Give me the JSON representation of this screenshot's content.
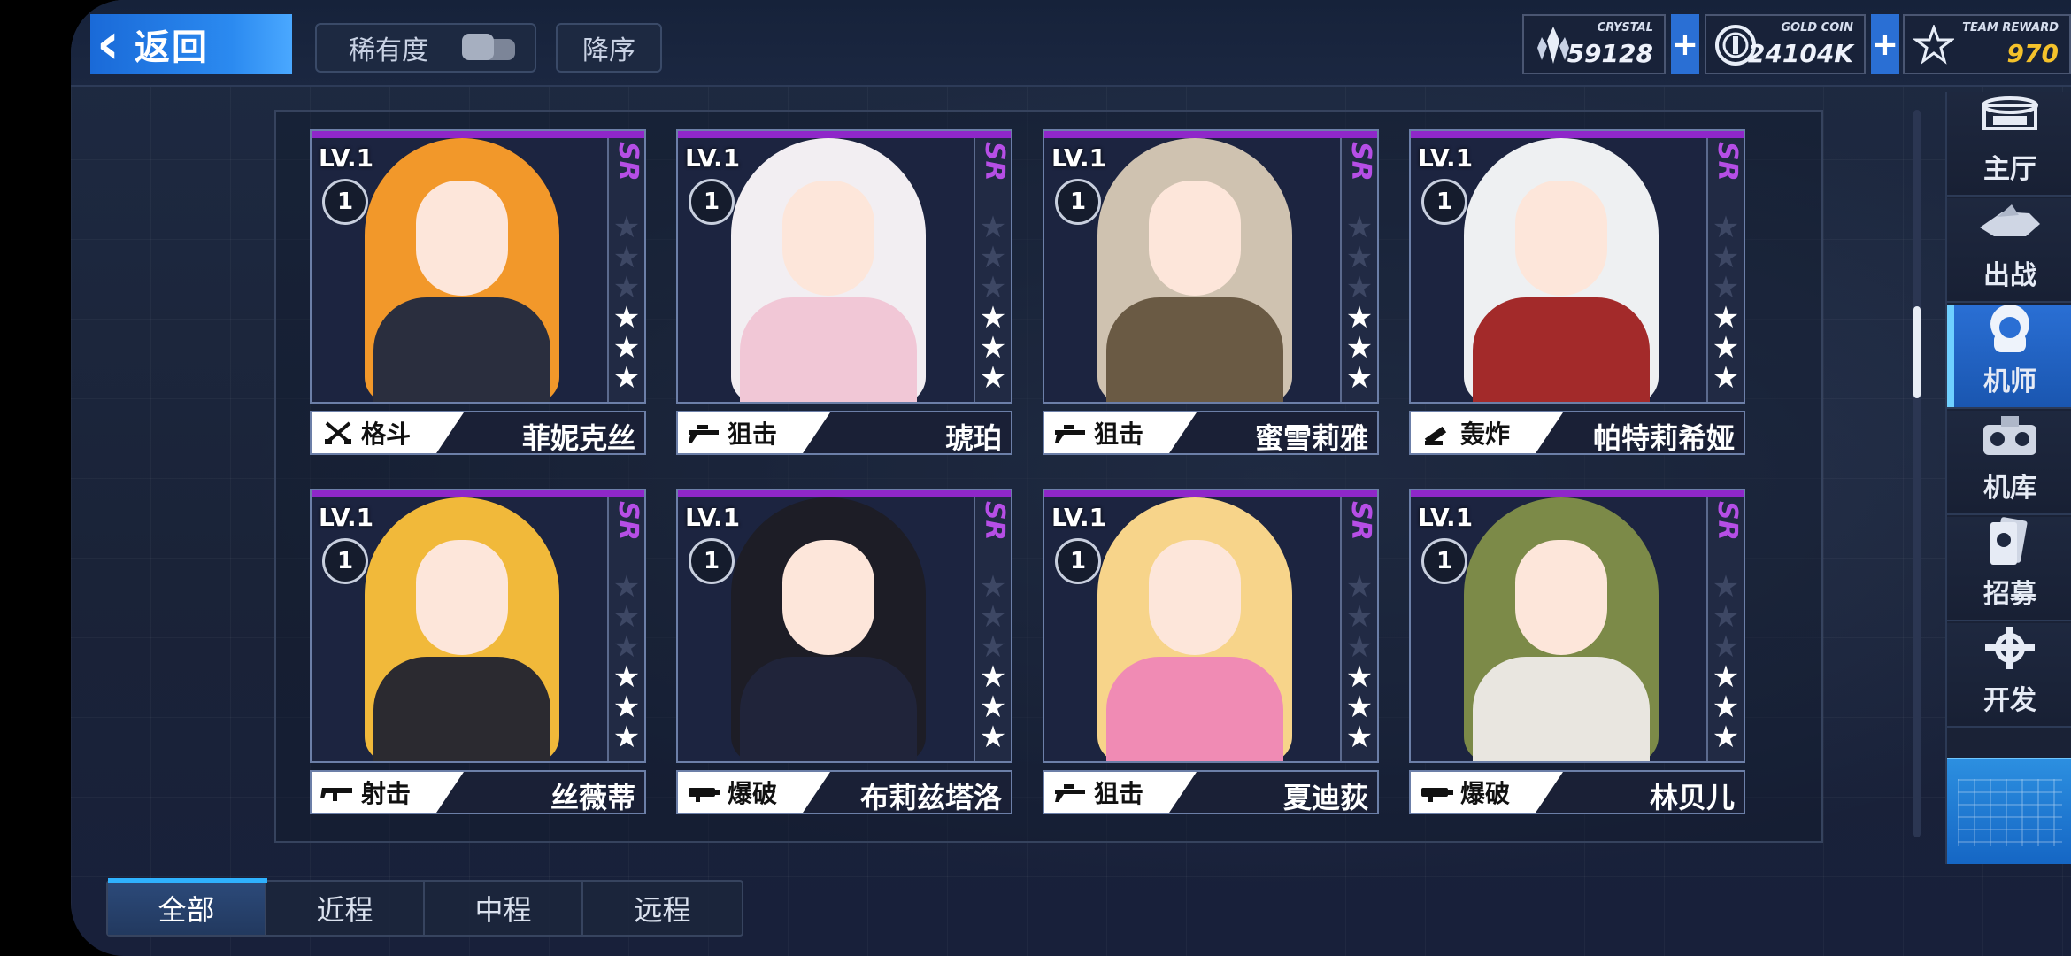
{
  "header": {
    "back_label": "返回",
    "rarity_label": "稀有度",
    "order_label": "降序"
  },
  "currencies": {
    "crystal": {
      "caption": "CRYSTAL",
      "value": "59128",
      "plus": "+"
    },
    "gold": {
      "caption": "GOLD COIN",
      "value": "24104K",
      "plus": "+"
    },
    "reward": {
      "caption": "TEAM REWARD",
      "value": "970"
    }
  },
  "nav": {
    "items": [
      {
        "label": "主厅",
        "icon": "hall-icon"
      },
      {
        "label": "出战",
        "icon": "sortie-icon"
      },
      {
        "label": "机师",
        "icon": "pilot-icon",
        "active": true
      },
      {
        "label": "机库",
        "icon": "hangar-icon"
      },
      {
        "label": "招募",
        "icon": "recruit-icon"
      },
      {
        "label": "开发",
        "icon": "develop-icon"
      }
    ]
  },
  "cards": [
    {
      "lv": "LV.1",
      "badge": "1",
      "rarity": "SR",
      "stars": 3,
      "role": "格斗",
      "role_icon": "melee-icon",
      "name": "菲妮克丝",
      "hair": "#f2982a",
      "outfit": "#2a2e3e"
    },
    {
      "lv": "LV.1",
      "badge": "1",
      "rarity": "SR",
      "stars": 3,
      "role": "狙击",
      "role_icon": "sniper-icon",
      "name": "琥珀",
      "hair": "#f2eef2",
      "outfit": "#f1c7d6"
    },
    {
      "lv": "LV.1",
      "badge": "1",
      "rarity": "SR",
      "stars": 3,
      "role": "狙击",
      "role_icon": "sniper-icon",
      "name": "蜜雪莉雅",
      "hair": "#cfc2b0",
      "outfit": "#6a5a44"
    },
    {
      "lv": "LV.1",
      "badge": "1",
      "rarity": "SR",
      "stars": 3,
      "role": "轰炸",
      "role_icon": "bomber-icon",
      "name": "帕特莉希娅",
      "hair": "#eef0f2",
      "outfit": "#a32a2a"
    },
    {
      "lv": "LV.1",
      "badge": "1",
      "rarity": "SR",
      "stars": 3,
      "role": "射击",
      "role_icon": "rifle-icon",
      "name": "丝薇蒂",
      "hair": "#f1b93a",
      "outfit": "#2b2a30"
    },
    {
      "lv": "LV.1",
      "badge": "1",
      "rarity": "SR",
      "stars": 3,
      "role": "爆破",
      "role_icon": "demolition-icon",
      "name": "布莉兹塔洛",
      "hair": "#1d1d26",
      "outfit": "#20243a"
    },
    {
      "lv": "LV.1",
      "badge": "1",
      "rarity": "SR",
      "stars": 3,
      "role": "狙击",
      "role_icon": "sniper-icon",
      "name": "夏迪荻",
      "hair": "#f7d48a",
      "outfit": "#f08bb4"
    },
    {
      "lv": "LV.1",
      "badge": "1",
      "rarity": "SR",
      "stars": 3,
      "role": "爆破",
      "role_icon": "demolition-icon",
      "name": "林贝儿",
      "hair": "#7c8a48",
      "outfit": "#e9e6e0"
    }
  ],
  "tabs": [
    {
      "label": "全部",
      "active": true
    },
    {
      "label": "近程"
    },
    {
      "label": "中程"
    },
    {
      "label": "远程"
    }
  ]
}
